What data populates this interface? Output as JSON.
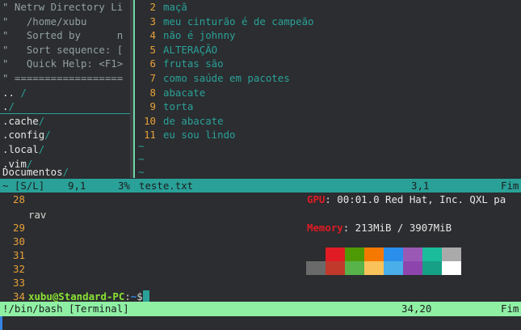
{
  "netrw": {
    "header": [
      "\" Netrw Directory Li",
      "\"   /home/xubu",
      "\"   Sorted by      n",
      "\"   Sort sequence: [",
      "\"   Quick Help: <F1>",
      "\" =================="
    ],
    "entries": [
      {
        "name": ".. ",
        "slash": "/"
      },
      {
        "name": ".",
        "slash": "/"
      },
      {
        "name": ".cache",
        "slash": "/"
      },
      {
        "name": ".config",
        "slash": "/"
      },
      {
        "name": ".local",
        "slash": "/"
      },
      {
        "name": ".vim",
        "slash": "/"
      },
      {
        "name": "Documentos",
        "slash": "/"
      }
    ]
  },
  "editor": {
    "lines": [
      {
        "num": "2",
        "text": "maçã"
      },
      {
        "num": "3",
        "text": "meu cinturão é de campeão"
      },
      {
        "num": "4",
        "text": "não é johnny"
      },
      {
        "num": "5",
        "text": "ALTERAÇÃO"
      },
      {
        "num": "6",
        "text": "frutas são"
      },
      {
        "num": "7",
        "text": "como saúde em pacotes"
      },
      {
        "num": "8",
        "text": "abacate"
      },
      {
        "num": "9",
        "text": "torta"
      },
      {
        "num": "10",
        "text": "de abacate"
      },
      {
        "num": "11",
        "text": "eu sou lindo"
      }
    ],
    "tildes": [
      "~",
      "~",
      "~"
    ]
  },
  "status_top": {
    "left_mode": "~ [S/L]",
    "left_pos": "9,1",
    "left_pct": "3%",
    "filename": "teste.txt",
    "cursor_pos": "3,1",
    "scroll": "Fim"
  },
  "terminal": {
    "line_numbers": [
      "28",
      "",
      "29",
      "30",
      "31",
      "32",
      "33",
      "34"
    ],
    "rav": "rav",
    "gpu_label": "GPU",
    "gpu_value": ": 00:01.0 Red Hat, Inc. QXL pa",
    "memory_label": "Memory",
    "memory_value": ": 213MiB / 3907MiB",
    "prompt_user": "xubu@Standard-PC",
    "prompt_sep": ":",
    "prompt_path": "~",
    "prompt_symbol": "$",
    "palette_top": [
      "#2b2d30",
      "#e01b24",
      "#4e9a06",
      "#f57900",
      "#2a8eeb",
      "#9b59b6",
      "#1abc9c",
      "#aaaaaa"
    ],
    "palette_bottom": [
      "#6a6a6a",
      "#c0392b",
      "#57b34a",
      "#f9c25a",
      "#4aaee8",
      "#8e44ad",
      "#16a085",
      "#ffffff"
    ]
  },
  "status_bottom": {
    "title": "!/bin/bash [Terminal]",
    "cursor_pos": "34,20",
    "scroll": "Fim"
  }
}
